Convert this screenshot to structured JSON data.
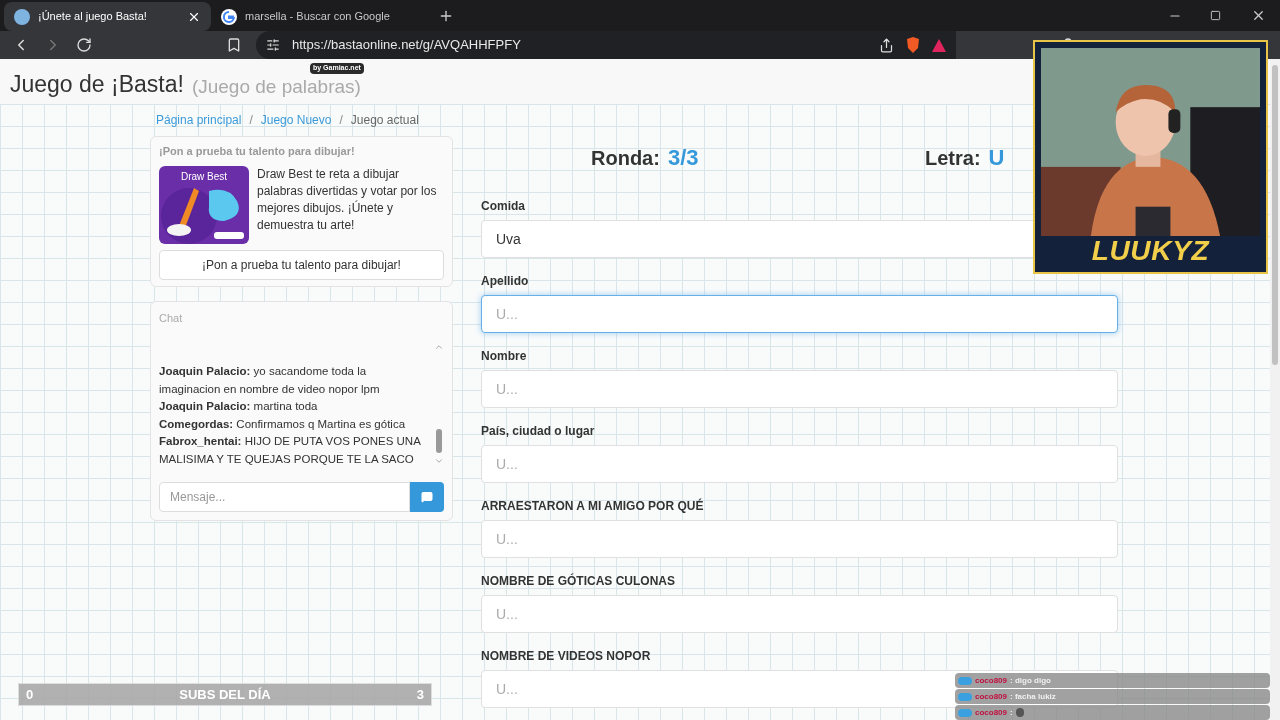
{
  "browser": {
    "tabs": [
      {
        "title": "¡Únete al juego Basta!",
        "selected": true
      },
      {
        "title": "marsella - Buscar con Google",
        "selected": false
      }
    ],
    "url": "https://bastaonline.net/g/AVQAHHFPFY"
  },
  "header": {
    "title": "Juego de ¡Basta!",
    "subtitle": "(Juego de palabras)",
    "badge": "by Gamiac.net"
  },
  "breadcrumbs": [
    {
      "label": "Página principal",
      "kind": "link"
    },
    {
      "separator": "/",
      "label": "Juego Nuevo",
      "kind": "link"
    },
    {
      "separator": "/",
      "label": "Juego actual",
      "kind": "current"
    }
  ],
  "promo": {
    "heading": "¡Pon a prueba tu talento para dibujar!",
    "thumbnail_title": "Draw Best",
    "description": "Draw Best te reta a dibujar palabras divertidas y votar por los mejores dibujos. ¡Únete y demuestra tu arte!",
    "button": "¡Pon a prueba tu talento para dibujar!"
  },
  "chat": {
    "title": "Chat",
    "messages": [
      {
        "user": "Joaquin Palacio:",
        "text": "yo sacandome toda la imaginacion en nombre de video nopor lpm"
      },
      {
        "user": "Joaquin Palacio:",
        "text": "martina toda"
      },
      {
        "user": "Comegordas:",
        "text": "Confirmamos q Martina es gótica"
      },
      {
        "user": "Fabrox_hentai:",
        "text": "HIJO DE PUTA VOS PONES UNA MALISIMA Y TE QUEJAS PORQUE TE LA SACO"
      }
    ],
    "placeholder": "Mensaje..."
  },
  "round": {
    "label": "Ronda:",
    "value": "3/3"
  },
  "letter": {
    "label": "Letra:",
    "value": "U"
  },
  "fields": [
    {
      "label": "Comida",
      "value": "Uva",
      "focused": false
    },
    {
      "label": "Apellido",
      "placeholder": "U...",
      "focused": true
    },
    {
      "label": "Nombre",
      "placeholder": "U...",
      "focused": false
    },
    {
      "label": "País, ciudad o lugar",
      "placeholder": "U...",
      "focused": false
    },
    {
      "label": "ARRAESTARON A MI AMIGO POR QUÉ",
      "placeholder": "U...",
      "focused": false
    },
    {
      "label": "NOMBRE DE GÓTICAS CULONAS",
      "placeholder": "U...",
      "focused": false
    },
    {
      "label": "NOMBRE DE VIDEOS NOPOR",
      "placeholder": "U...",
      "focused": false
    }
  ],
  "stream": {
    "name": "LUUKYZ",
    "subs": {
      "start": "0",
      "label": "SUBS DEL DÍA",
      "goal": "3"
    },
    "chat": [
      {
        "user": "coco809",
        "kind": "text",
        "text": ": digo digo"
      },
      {
        "user": "coco809",
        "kind": "text",
        "text": ": facha lukiz"
      },
      {
        "user": "coco809",
        "kind": "emote",
        "text": ":"
      }
    ]
  }
}
